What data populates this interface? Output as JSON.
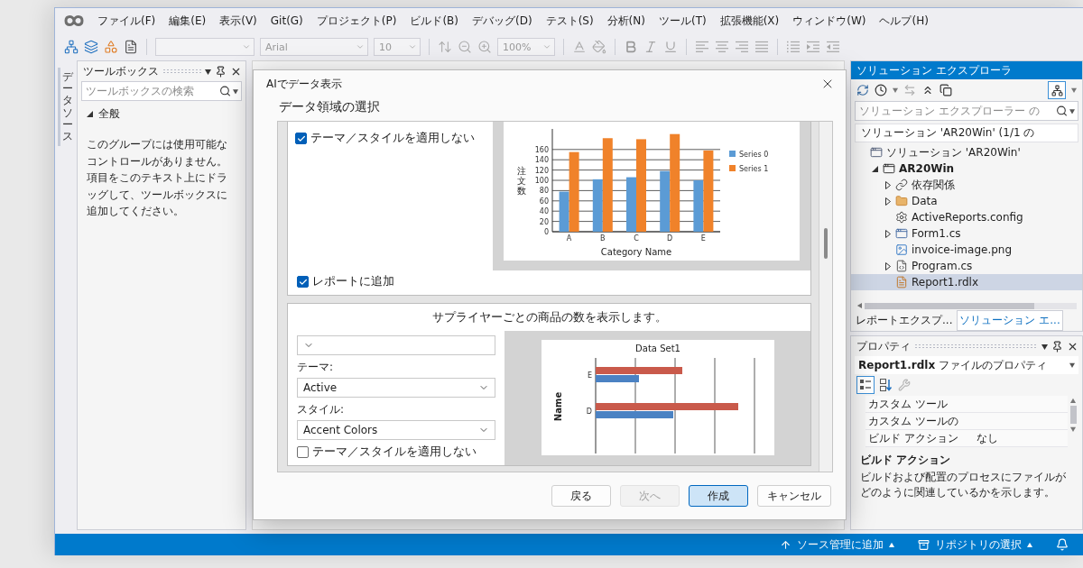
{
  "menu_bar": {
    "items": [
      "ファイル(F)",
      "編集(E)",
      "表示(V)",
      "Git(G)",
      "プロジェクト(P)",
      "ビルド(B)",
      "デバッグ(D)",
      "テスト(S)",
      "分析(N)",
      "ツール(T)",
      "拡張機能(X)",
      "ウィンドウ(W)",
      "ヘルプ(H)"
    ]
  },
  "toolbar": {
    "font": "Arial",
    "font_size": "10",
    "zoom": "100%"
  },
  "side_tabs": [
    {
      "label": "データソース"
    }
  ],
  "toolbox": {
    "title": "ツールボックス",
    "search": {
      "placeholder": "ツールボックスの検索"
    },
    "group": {
      "label": "全般",
      "expanded": true
    },
    "message": "このグループには使用可能なコントロールがありません。項目をこのテキスト上にドラッグして、ツールボックスに追加してください。"
  },
  "dialog": {
    "title": "AIでデータ表示",
    "heading": "データ領域の選択",
    "cards": [
      {
        "controls": [
          {
            "kind": "checkbox",
            "label": "テーマ／スタイルを適用しない",
            "checked": true
          }
        ],
        "chart_data": {
          "type": "bar",
          "xlabel": "Category Name",
          "ylabel": "注文数",
          "categories": [
            "A",
            "B",
            "C",
            "D",
            "E"
          ],
          "series": [
            {
              "name": "Series 0",
              "color": "#5b9bd5",
              "values": [
                78,
                102,
                106,
                118,
                100
              ]
            },
            {
              "name": "Series 1",
              "color": "#f0822a",
              "values": [
                155,
                182,
                180,
                190,
                158
              ]
            }
          ],
          "ylim": [
            0,
            200
          ],
          "yticks": [
            0,
            20,
            40,
            60,
            80,
            100,
            120,
            140,
            160
          ],
          "grid": true,
          "legend": "right"
        },
        "add_to_report": {
          "label": "レポートに追加",
          "checked": true
        }
      },
      {
        "description": "サプライヤーごとの商品の数を表示します。",
        "controls": [
          {
            "kind": "select"
          },
          {
            "kind": "label",
            "text": "テーマ:"
          },
          {
            "kind": "select",
            "value": "Active"
          },
          {
            "kind": "label",
            "text": "スタイル:"
          },
          {
            "kind": "select",
            "value": "Accent Colors"
          },
          {
            "kind": "checkbox",
            "label": "テーマ／スタイルを適用しない",
            "checked": false
          }
        ],
        "preview": {
          "title": "Data Set1",
          "axis_label": "Name",
          "labels": [
            "E",
            "D"
          ]
        }
      }
    ],
    "buttons": [
      {
        "label": "戻る",
        "disabled": false,
        "focused": false
      },
      {
        "label": "次へ",
        "disabled": true,
        "focused": false
      },
      {
        "label": "作成",
        "disabled": false,
        "focused": true
      },
      {
        "label": "キャンセル",
        "disabled": false,
        "focused": false
      }
    ]
  },
  "solution_explorer": {
    "title": "ソリューション エクスプローラ",
    "search": {
      "placeholder": "ソリューション エクスプローラー の"
    },
    "sticky_header": "ソリューション 'AR20Win' (1/1 の",
    "tree": [
      {
        "label": "ソリューション 'AR20Win'",
        "kind": "solution",
        "selected": false,
        "children": [
          {
            "label": "AR20Win",
            "kind": "project",
            "expanded": true,
            "selected": false,
            "children": [
              {
                "label": "依存関係",
                "kind": "dependencies",
                "expanded": false,
                "selected": false
              },
              {
                "label": "Data",
                "kind": "folder",
                "expanded": false,
                "selected": false
              },
              {
                "label": "ActiveReports.config",
                "kind": "config",
                "selected": false
              },
              {
                "label": "Form1.cs",
                "kind": "form",
                "expanded": false,
                "selected": false
              },
              {
                "label": "invoice-image.png",
                "kind": "image",
                "selected": false
              },
              {
                "label": "Program.cs",
                "kind": "csharp",
                "expanded": false,
                "selected": false
              },
              {
                "label": "Report1.rdlx",
                "kind": "report",
                "selected": true
              }
            ]
          }
        ]
      }
    ]
  },
  "bottom_tabs": [
    {
      "label": "レポートエクスプ...",
      "selected": false
    },
    {
      "label": "ソリューション エ...",
      "selected": true
    }
  ],
  "properties": {
    "title": "プロパティ",
    "object": "**Report1.rdlx** ファイルのプロパティ",
    "rows": [
      {
        "name": "カスタム ツール"
      },
      {
        "name": "カスタム ツールの"
      },
      {
        "name": "ビルド アクション",
        "value": "なし"
      }
    ],
    "description": {
      "title": "ビルド アクション",
      "text": "ビルドおよび配置のプロセスにファイルがどのように関連しているかを示します。"
    }
  },
  "status_bar": {
    "items": [
      {
        "kind": "source-control",
        "label": "ソース管理に追加"
      },
      {
        "kind": "repository",
        "label": "リポジトリの選択"
      }
    ]
  }
}
